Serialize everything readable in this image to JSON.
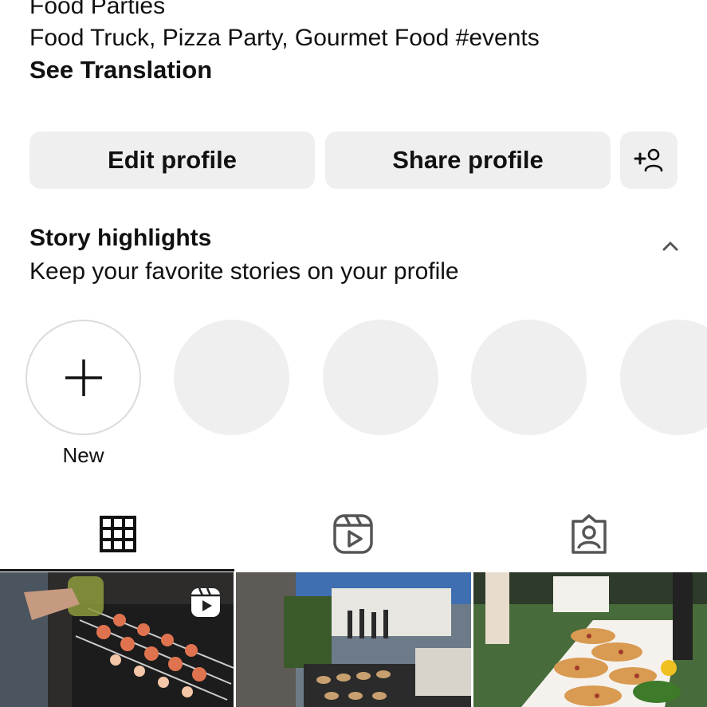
{
  "bio": {
    "line1": "Food Parties",
    "line2": "Food Truck, Pizza Party, Gourmet Food #events",
    "see_translation": "See Translation"
  },
  "actions": {
    "edit_label": "Edit profile",
    "share_label": "Share profile",
    "add_person_icon": "add-person-icon"
  },
  "highlights": {
    "title": "Story highlights",
    "subtitle": "Keep your favorite stories on your profile",
    "new_label": "New",
    "placeholder_count": 4
  },
  "tabs": [
    {
      "icon": "grid-icon",
      "selected": true
    },
    {
      "icon": "reels-icon",
      "selected": false
    },
    {
      "icon": "tagged-icon",
      "selected": false
    }
  ],
  "posts": [
    {
      "description": "skewers",
      "type": "reel"
    },
    {
      "description": "outdoor-grill-party",
      "type": "photo"
    },
    {
      "description": "pizza-buffet",
      "type": "photo"
    }
  ],
  "colors": {
    "button_bg": "#efefef",
    "text": "#111111",
    "placeholder": "#efefef"
  }
}
